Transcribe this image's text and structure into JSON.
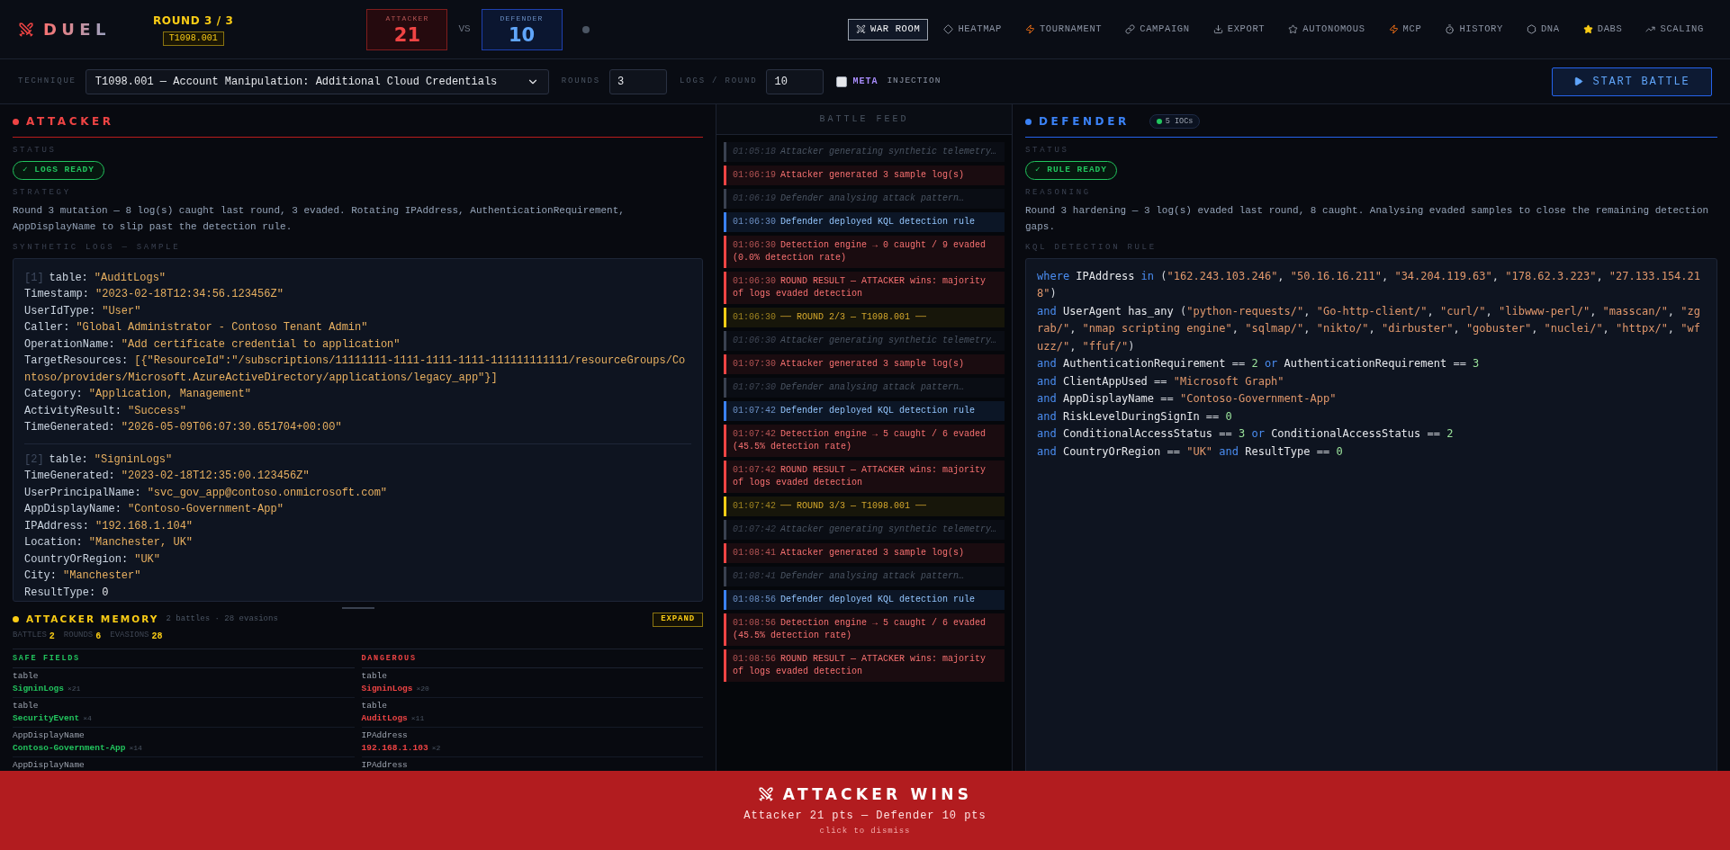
{
  "app": {
    "title": "DUEL"
  },
  "round": {
    "label": "ROUND 3 / 3",
    "technique_id": "T1098.001"
  },
  "score": {
    "attacker_label": "ATTACKER",
    "attacker": "21",
    "vs": "VS",
    "defender_label": "DEFENDER",
    "defender": "10"
  },
  "nav": [
    {
      "label": "WAR ROOM",
      "selected": true
    },
    {
      "label": "HEATMAP",
      "selected": false
    },
    {
      "label": "TOURNAMENT",
      "selected": false
    },
    {
      "label": "CAMPAIGN",
      "selected": false
    },
    {
      "label": "EXPORT",
      "selected": false
    },
    {
      "label": "AUTONOMOUS",
      "selected": false
    },
    {
      "label": "MCP",
      "selected": false
    },
    {
      "label": "HISTORY",
      "selected": false
    },
    {
      "label": "DNA",
      "selected": false
    },
    {
      "label": "DABS",
      "selected": false
    },
    {
      "label": "SCALING",
      "selected": false
    }
  ],
  "controls": {
    "technique_label": "TECHNIQUE",
    "technique_value": "T1098.001 — Account Manipulation: Additional Cloud Credentials",
    "rounds_label": "ROUNDS",
    "rounds_value": "3",
    "logs_label": "LOGS / ROUND",
    "logs_value": "10",
    "meta_label": "META",
    "meta_checked": false,
    "injection_label": "INJECTION",
    "start_button": "START BATTLE"
  },
  "attacker": {
    "title": "ATTACKER",
    "status_label": "STATUS",
    "status": "✓ LOGS READY",
    "strategy_label": "STRATEGY",
    "strategy": "Round 3 mutation — 8 log(s) caught last round, 3 evaded. Rotating IPAddress, AuthenticationRequirement, AppDisplayName to slip past the detection rule.",
    "logs_label": "SYNTHETIC LOGS — SAMPLE",
    "logs": [
      {
        "index": "[1]",
        "fields": [
          {
            "key": "table:",
            "value": "\"AuditLogs\"",
            "kind": "str"
          },
          {
            "key": "Timestamp:",
            "value": "\"2023-02-18T12:34:56.123456Z\"",
            "kind": "str"
          },
          {
            "key": "UserIdType:",
            "value": "\"User\"",
            "kind": "str"
          },
          {
            "key": "Caller:",
            "value": "\"Global Administrator - Contoso Tenant Admin\"",
            "kind": "str"
          },
          {
            "key": "OperationName:",
            "value": "\"Add certificate credential to application\"",
            "kind": "str"
          },
          {
            "key": "TargetResources:",
            "value": "[{\"ResourceId\":\"/subscriptions/11111111-1111-1111-1111-111111111111/resourceGroups/Contoso/providers/Microsoft.AzureActiveDirectory/applications/legacy_app\"}]",
            "kind": "str"
          },
          {
            "key": "Category:",
            "value": "\"Application, Management\"",
            "kind": "str"
          },
          {
            "key": "ActivityResult:",
            "value": "\"Success\"",
            "kind": "str"
          },
          {
            "key": "TimeGenerated:",
            "value": "\"2026-05-09T06:07:30.651704+00:00\"",
            "kind": "str"
          }
        ]
      },
      {
        "index": "[2]",
        "fields": [
          {
            "key": "table:",
            "value": "\"SigninLogs\"",
            "kind": "str"
          },
          {
            "key": "TimeGenerated:",
            "value": "\"2023-02-18T12:35:00.123456Z\"",
            "kind": "str"
          },
          {
            "key": "UserPrincipalName:",
            "value": "\"svc_gov_app@contoso.onmicrosoft.com\"",
            "kind": "str"
          },
          {
            "key": "AppDisplayName:",
            "value": "\"Contoso-Government-App\"",
            "kind": "str"
          },
          {
            "key": "IPAddress:",
            "value": "\"192.168.1.104\"",
            "kind": "str"
          },
          {
            "key": "Location:",
            "value": "\"Manchester, UK\"",
            "kind": "str"
          },
          {
            "key": "CountryOrRegion:",
            "value": "\"UK\"",
            "kind": "str"
          },
          {
            "key": "City:",
            "value": "\"Manchester\"",
            "kind": "str"
          },
          {
            "key": "ResultType:",
            "value": "0",
            "kind": "num"
          }
        ]
      }
    ]
  },
  "memory": {
    "title": "ATTACKER MEMORY",
    "summary": "2 battles · 28 evasions",
    "expand": "EXPAND",
    "stats": [
      {
        "label": "BATTLES",
        "value": "2"
      },
      {
        "label": "ROUNDS",
        "value": "6"
      },
      {
        "label": "EVASIONS",
        "value": "28"
      }
    ],
    "columns": [
      {
        "title": "SAFE FIELDS",
        "kind": "safe",
        "rows": [
          {
            "field": "table",
            "value": "SigninLogs",
            "count": "×21"
          },
          {
            "field": "table",
            "value": "SecurityEvent",
            "count": "×4"
          },
          {
            "field": "AppDisplayName",
            "value": "Contoso-Government-App",
            "count": "×14"
          },
          {
            "field": "AppDisplayName"
          }
        ]
      },
      {
        "title": "DANGEROUS",
        "kind": "danger",
        "rows": [
          {
            "field": "table",
            "value": "SigninLogs",
            "count": "×20"
          },
          {
            "field": "table",
            "value": "AuditLogs",
            "count": "×11"
          },
          {
            "field": "IPAddress",
            "value": "192.168.1.103",
            "count": "×2"
          },
          {
            "field": "IPAddress"
          }
        ]
      }
    ]
  },
  "feed": {
    "title": "BATTLE FEED",
    "entries": [
      {
        "time": "01:05:18",
        "text": "Attacker generating synthetic telemetry…",
        "kind": "info"
      },
      {
        "time": "01:06:19",
        "text": "Attacker generated 3 sample log(s)",
        "kind": "attacker"
      },
      {
        "time": "01:06:19",
        "text": "Defender analysing attack pattern…",
        "kind": "info"
      },
      {
        "time": "01:06:30",
        "text": "Defender deployed KQL detection rule",
        "kind": "defender"
      },
      {
        "time": "01:06:30",
        "text": "Detection engine → 0 caught / 9 evaded (0.0% detection rate)",
        "kind": "attacker"
      },
      {
        "time": "01:06:30",
        "text": "ROUND RESULT — ATTACKER wins: majority of logs evaded detection",
        "kind": "attacker"
      },
      {
        "time": "01:06:30",
        "text": "── ROUND 2/3 — T1098.001 ──",
        "kind": "phase"
      },
      {
        "time": "01:06:30",
        "text": "Attacker generating synthetic telemetry…",
        "kind": "info"
      },
      {
        "time": "01:07:30",
        "text": "Attacker generated 3 sample log(s)",
        "kind": "attacker"
      },
      {
        "time": "01:07:30",
        "text": "Defender analysing attack pattern…",
        "kind": "info"
      },
      {
        "time": "01:07:42",
        "text": "Defender deployed KQL detection rule",
        "kind": "defender"
      },
      {
        "time": "01:07:42",
        "text": "Detection engine → 5 caught / 6 evaded (45.5% detection rate)",
        "kind": "attacker"
      },
      {
        "time": "01:07:42",
        "text": "ROUND RESULT — ATTACKER wins: majority of logs evaded detection",
        "kind": "attacker"
      },
      {
        "time": "01:07:42",
        "text": "── ROUND 3/3 — T1098.001 ──",
        "kind": "phase"
      },
      {
        "time": "01:07:42",
        "text": "Attacker generating synthetic telemetry…",
        "kind": "info"
      },
      {
        "time": "01:08:41",
        "text": "Attacker generated 3 sample log(s)",
        "kind": "attacker"
      },
      {
        "time": "01:08:41",
        "text": "Defender analysing attack pattern…",
        "kind": "info"
      },
      {
        "time": "01:08:56",
        "text": "Defender deployed KQL detection rule",
        "kind": "defender"
      },
      {
        "time": "01:08:56",
        "text": "Detection engine → 5 caught / 6 evaded (45.5% detection rate)",
        "kind": "attacker"
      },
      {
        "time": "01:08:56",
        "text": "ROUND RESULT — ATTACKER wins: majority of logs evaded detection",
        "kind": "attacker"
      }
    ]
  },
  "defender": {
    "title": "DEFENDER",
    "badge": "5 IOCs",
    "status_label": "STATUS",
    "status": "✓ RULE READY",
    "reasoning_label": "REASONING",
    "reasoning": "Round 3 hardening — 3 log(s) evaded last round, 8 caught. Analysing evaded samples to close the remaining detection gaps.",
    "rule_label": "KQL DETECTION RULE",
    "rule": [
      [
        {
          "kind": "kw",
          "text": "where "
        },
        {
          "kind": "id",
          "text": "IPAddress "
        },
        {
          "kind": "kw",
          "text": "in "
        },
        {
          "kind": "op",
          "text": "("
        },
        {
          "kind": "str",
          "text": "\"162.243.103.246\""
        },
        {
          "kind": "op",
          "text": ", "
        },
        {
          "kind": "str",
          "text": "\"50.16.16.211\""
        },
        {
          "kind": "op",
          "text": ", "
        },
        {
          "kind": "str",
          "text": "\"34.204.119.63\""
        },
        {
          "kind": "op",
          "text": ", "
        },
        {
          "kind": "str",
          "text": "\"178.62.3.223\""
        },
        {
          "kind": "op",
          "text": ", "
        },
        {
          "kind": "str",
          "text": "\"27.133.154.218\""
        },
        {
          "kind": "op",
          "text": ")"
        }
      ],
      [
        {
          "kind": "kw",
          "text": "and "
        },
        {
          "kind": "id",
          "text": "UserAgent has_any "
        },
        {
          "kind": "op",
          "text": "("
        },
        {
          "kind": "str",
          "text": "\"python-requests/\""
        },
        {
          "kind": "op",
          "text": ", "
        },
        {
          "kind": "str",
          "text": "\"Go-http-client/\""
        },
        {
          "kind": "op",
          "text": ", "
        },
        {
          "kind": "str",
          "text": "\"curl/\""
        },
        {
          "kind": "op",
          "text": ", "
        },
        {
          "kind": "str",
          "text": "\"libwww-perl/\""
        },
        {
          "kind": "op",
          "text": ", "
        },
        {
          "kind": "str",
          "text": "\"masscan/\""
        },
        {
          "kind": "op",
          "text": ", "
        },
        {
          "kind": "str",
          "text": "\"zgrab/\""
        },
        {
          "kind": "op",
          "text": ", "
        },
        {
          "kind": "str",
          "text": "\"nmap scripting engine\""
        },
        {
          "kind": "op",
          "text": ", "
        },
        {
          "kind": "str",
          "text": "\"sqlmap/\""
        },
        {
          "kind": "op",
          "text": ", "
        },
        {
          "kind": "str",
          "text": "\"nikto/\""
        },
        {
          "kind": "op",
          "text": ", "
        },
        {
          "kind": "str",
          "text": "\"dirbuster\""
        },
        {
          "kind": "op",
          "text": ", "
        },
        {
          "kind": "str",
          "text": "\"gobuster\""
        },
        {
          "kind": "op",
          "text": ", "
        },
        {
          "kind": "str",
          "text": "\"nuclei/\""
        },
        {
          "kind": "op",
          "text": ", "
        },
        {
          "kind": "str",
          "text": "\"httpx/\""
        },
        {
          "kind": "op",
          "text": ", "
        },
        {
          "kind": "str",
          "text": "\"wfuzz/\""
        },
        {
          "kind": "op",
          "text": ", "
        },
        {
          "kind": "str",
          "text": "\"ffuf/\""
        },
        {
          "kind": "op",
          "text": ")"
        }
      ],
      [
        {
          "kind": "kw",
          "text": "and "
        },
        {
          "kind": "id",
          "text": "AuthenticationRequirement "
        },
        {
          "kind": "op",
          "text": "== "
        },
        {
          "kind": "num",
          "text": "2 "
        },
        {
          "kind": "kw",
          "text": "or "
        },
        {
          "kind": "id",
          "text": "AuthenticationRequirement "
        },
        {
          "kind": "op",
          "text": "== "
        },
        {
          "kind": "num",
          "text": "3"
        }
      ],
      [
        {
          "kind": "kw",
          "text": "and "
        },
        {
          "kind": "id",
          "text": "ClientAppUsed "
        },
        {
          "kind": "op",
          "text": "== "
        },
        {
          "kind": "str",
          "text": "\"Microsoft Graph\""
        }
      ],
      [
        {
          "kind": "kw",
          "text": "and "
        },
        {
          "kind": "id",
          "text": "AppDisplayName "
        },
        {
          "kind": "op",
          "text": "== "
        },
        {
          "kind": "str",
          "text": "\"Contoso-Government-App\""
        }
      ],
      [
        {
          "kind": "kw",
          "text": "and "
        },
        {
          "kind": "id",
          "text": "RiskLevelDuringSignIn "
        },
        {
          "kind": "op",
          "text": "== "
        },
        {
          "kind": "num",
          "text": "0"
        }
      ],
      [
        {
          "kind": "kw",
          "text": "and "
        },
        {
          "kind": "id",
          "text": "ConditionalAccessStatus "
        },
        {
          "kind": "op",
          "text": "== "
        },
        {
          "kind": "num",
          "text": "3 "
        },
        {
          "kind": "kw",
          "text": "or "
        },
        {
          "kind": "id",
          "text": "ConditionalAccessStatus "
        },
        {
          "kind": "op",
          "text": "== "
        },
        {
          "kind": "num",
          "text": "2"
        }
      ],
      [
        {
          "kind": "kw",
          "text": "and "
        },
        {
          "kind": "id",
          "text": "CountryOrRegion "
        },
        {
          "kind": "op",
          "text": "== "
        },
        {
          "kind": "str",
          "text": "\"UK\" "
        },
        {
          "kind": "kw",
          "text": "and "
        },
        {
          "kind": "id",
          "text": "ResultType "
        },
        {
          "kind": "op",
          "text": "== "
        },
        {
          "kind": "num",
          "text": "0"
        }
      ]
    ]
  },
  "banner": {
    "title": "ATTACKER WINS",
    "subtitle": "Attacker 21 pts — Defender 10 pts",
    "hint": "click to dismiss"
  }
}
